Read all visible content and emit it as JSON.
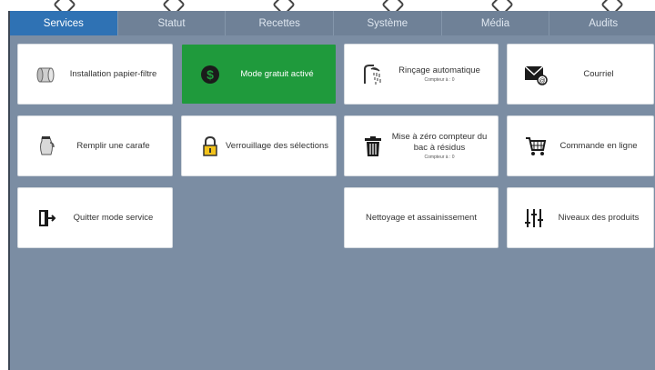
{
  "tabs": [
    {
      "label": "Services",
      "active": true
    },
    {
      "label": "Statut",
      "active": false
    },
    {
      "label": "Recettes",
      "active": false
    },
    {
      "label": "Système",
      "active": false
    },
    {
      "label": "Média",
      "active": false
    },
    {
      "label": "Audits",
      "active": false
    }
  ],
  "tiles": {
    "installation_filtre": {
      "label": "Installation papier-filtre",
      "icon": "paper-roll-icon"
    },
    "mode_gratuit": {
      "label": "Mode gratuit activé",
      "icon": "dollar-coin-icon",
      "color": "#1f9a3c"
    },
    "rincage": {
      "label": "Rinçage automatique",
      "sub": "Compteur à : 0",
      "icon": "shower-icon"
    },
    "courriel": {
      "label": "Courriel",
      "icon": "email-icon"
    },
    "remplir_carafe": {
      "label": "Remplir une carafe",
      "icon": "carafe-icon"
    },
    "verrouillage": {
      "label": "Verrouillage des sélections",
      "icon": "padlock-icon"
    },
    "remise_zero": {
      "label": "Mise à zéro compteur du bac à résidus",
      "sub": "Compteur à : 0",
      "icon": "trash-bin-icon"
    },
    "commande": {
      "label": "Commande en ligne",
      "icon": "shopping-cart-icon"
    },
    "quitter": {
      "label": "Quitter mode service",
      "icon": "exit-door-icon"
    },
    "nettoyage": {
      "label": "Nettoyage et assainissement"
    },
    "niveaux": {
      "label": "Niveaux des produits",
      "icon": "level-sliders-icon"
    }
  },
  "colors": {
    "background": "#7b8da3",
    "tab_active": "#2f72b4",
    "tile_green": "#1f9a3c"
  }
}
